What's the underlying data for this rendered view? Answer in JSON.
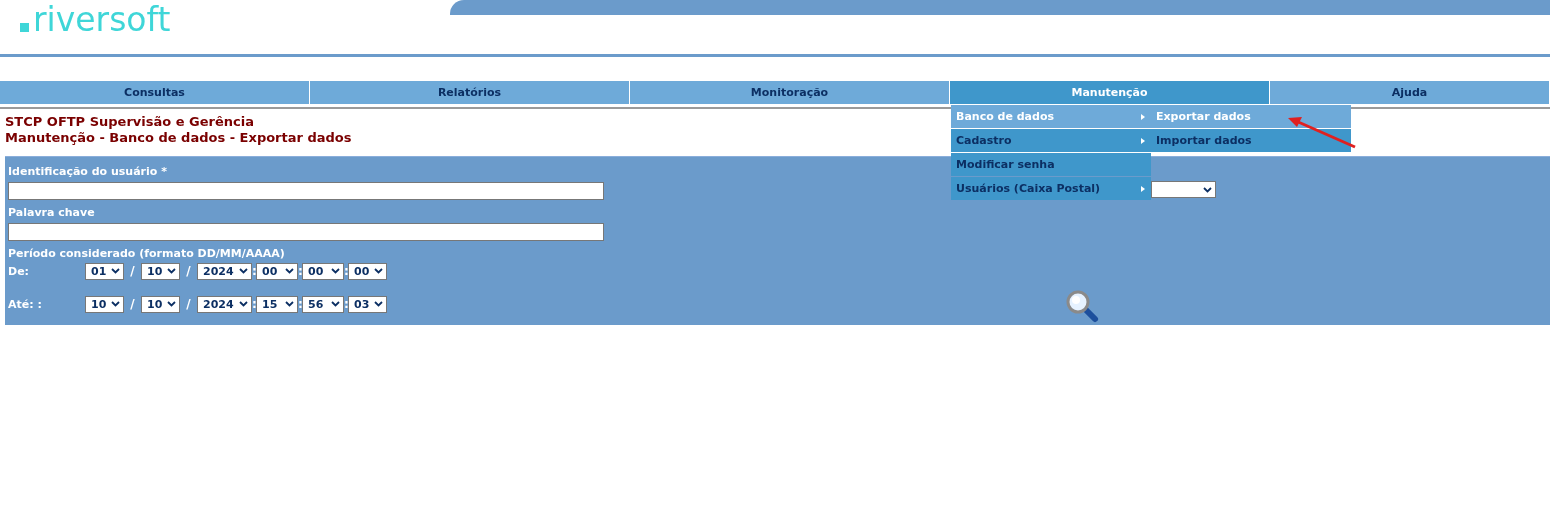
{
  "logo": {
    "text": "riversoft"
  },
  "nav": [
    {
      "label": "Consultas",
      "selected": false
    },
    {
      "label": "Relatórios",
      "selected": false
    },
    {
      "label": "Monitoração",
      "selected": false
    },
    {
      "label": "Manutenção",
      "selected": true
    },
    {
      "label": "Ajuda",
      "selected": false
    }
  ],
  "menu": {
    "items": [
      {
        "label": "Banco de dados",
        "selected": true,
        "has_submenu": true
      },
      {
        "label": "Cadastro",
        "selected": false,
        "has_submenu": true
      },
      {
        "label": "Modificar senha",
        "selected": false,
        "has_submenu": false
      },
      {
        "label": "Usuários (Caixa Postal)",
        "selected": false,
        "has_submenu": true
      }
    ],
    "submenu": [
      {
        "label": "Exportar dados",
        "selected": true
      },
      {
        "label": "Importar dados",
        "selected": false
      }
    ]
  },
  "header": {
    "title": "STCP OFTP Supervisão e Gerência",
    "breadcrumb": "Manutenção - Banco de dados - Exportar dados"
  },
  "form": {
    "fields": [
      {
        "label": "Identificação do usuário *"
      },
      {
        "label": "Palavra chave"
      }
    ],
    "period_label": "Período considerado (formato DD/MM/AAAA)",
    "date_rows": [
      {
        "label": "De:",
        "day": "01",
        "month": "10",
        "year": "2024",
        "hour": "00",
        "minute": "00",
        "second": "00"
      },
      {
        "label": "Até: :",
        "day": "10",
        "month": "10",
        "year": "2024",
        "hour": "15",
        "minute": "56",
        "second": "03"
      }
    ],
    "date_separator": "/",
    "time_separator": ":"
  }
}
